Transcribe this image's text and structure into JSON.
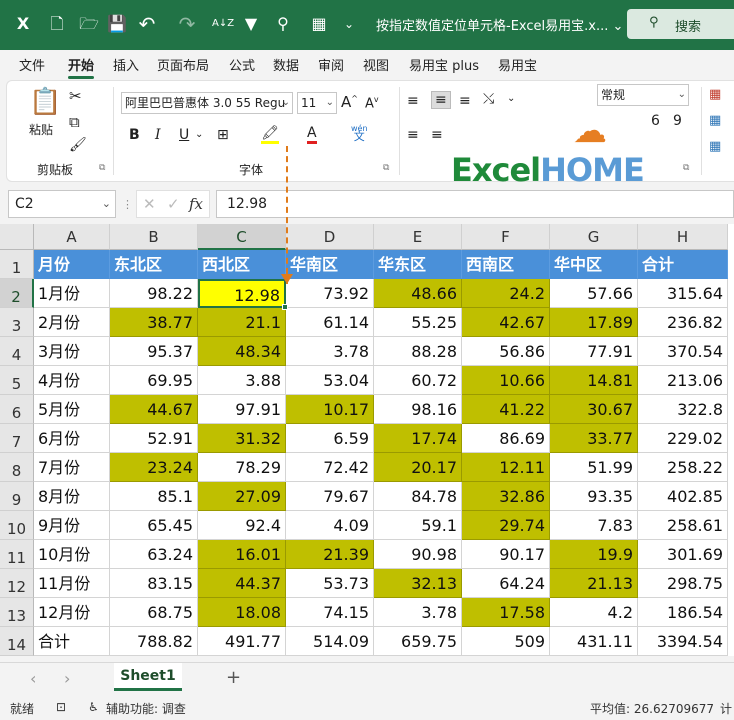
{
  "titlebar": {
    "title": "按指定数值定位单元格-Excel易用宝.x...",
    "dropdown_icon": "⌄",
    "search_label": "搜索",
    "icons": {
      "app": "X",
      "new": "🗋",
      "open": "🗁",
      "save": "💾",
      "undo": "↶",
      "redo": "↷",
      "sort": "A↓Z",
      "find": "⚲",
      "form": "▦"
    }
  },
  "menu": {
    "items": [
      "文件",
      "开始",
      "插入",
      "页面布局",
      "公式",
      "数据",
      "审阅",
      "视图",
      "易用宝 plus",
      "易用宝"
    ],
    "active": "开始"
  },
  "ribbon": {
    "paste_label": "粘贴",
    "clipboard_label": "剪贴板",
    "font_name": "阿里巴巴普惠体 3.0 55 Regu",
    "font_size": "11",
    "font_label": "字体",
    "bold": "B",
    "italic": "I",
    "underline": "U",
    "grow": "A",
    "shrink": "A",
    "wen": "wén",
    "wen_sub": "文",
    "number_format": "常规",
    "logo_excel": "Excel",
    "logo_home": "HOME"
  },
  "formula_bar": {
    "name_box": "C2",
    "fx": "fx",
    "value": "12.98"
  },
  "sheet": {
    "columns": [
      "A",
      "B",
      "C",
      "D",
      "E",
      "F",
      "G",
      "H"
    ],
    "rows": [
      [
        "月份",
        "东北区",
        "西北区",
        "华南区",
        "华东区",
        "西南区",
        "华中区",
        "合计"
      ],
      [
        "1月份",
        "98.22",
        "12.98",
        "73.92",
        "48.66",
        "24.2",
        "57.66",
        "315.64"
      ],
      [
        "2月份",
        "38.77",
        "21.1",
        "61.14",
        "55.25",
        "42.67",
        "17.89",
        "236.82"
      ],
      [
        "3月份",
        "95.37",
        "48.34",
        "3.78",
        "88.28",
        "56.86",
        "77.91",
        "370.54"
      ],
      [
        "4月份",
        "69.95",
        "3.88",
        "53.04",
        "60.72",
        "10.66",
        "14.81",
        "213.06"
      ],
      [
        "5月份",
        "44.67",
        "97.91",
        "10.17",
        "98.16",
        "41.22",
        "30.67",
        "322.8"
      ],
      [
        "6月份",
        "52.91",
        "31.32",
        "6.59",
        "17.74",
        "86.69",
        "33.77",
        "229.02"
      ],
      [
        "7月份",
        "23.24",
        "78.29",
        "72.42",
        "20.17",
        "12.11",
        "51.99",
        "258.22"
      ],
      [
        "8月份",
        "85.1",
        "27.09",
        "79.67",
        "84.78",
        "32.86",
        "93.35",
        "402.85"
      ],
      [
        "9月份",
        "65.45",
        "92.4",
        "4.09",
        "59.1",
        "29.74",
        "7.83",
        "258.61"
      ],
      [
        "10月份",
        "63.24",
        "16.01",
        "21.39",
        "90.98",
        "90.17",
        "19.9",
        "301.69"
      ],
      [
        "11月份",
        "83.15",
        "44.37",
        "53.73",
        "32.13",
        "64.24",
        "21.13",
        "298.75"
      ],
      [
        "12月份",
        "68.75",
        "18.08",
        "74.15",
        "3.78",
        "17.58",
        "4.2",
        "186.54"
      ],
      [
        "合计",
        "788.82",
        "491.77",
        "514.09",
        "659.75",
        "509",
        "431.11",
        "3394.54"
      ]
    ],
    "highlight_color": "#bfbf00",
    "active_cell_color": "#ffff00",
    "header_color": "#4a90d9",
    "highlighted": [
      [
        2,
        4
      ],
      [
        2,
        5
      ],
      [
        3,
        1
      ],
      [
        3,
        2
      ],
      [
        3,
        5
      ],
      [
        3,
        6
      ],
      [
        4,
        2
      ],
      [
        5,
        5
      ],
      [
        5,
        6
      ],
      [
        6,
        1
      ],
      [
        6,
        3
      ],
      [
        6,
        5
      ],
      [
        6,
        6
      ],
      [
        7,
        2
      ],
      [
        7,
        4
      ],
      [
        7,
        6
      ],
      [
        8,
        1
      ],
      [
        8,
        4
      ],
      [
        8,
        5
      ],
      [
        9,
        2
      ],
      [
        9,
        5
      ],
      [
        10,
        5
      ],
      [
        11,
        2
      ],
      [
        11,
        3
      ],
      [
        11,
        6
      ],
      [
        12,
        2
      ],
      [
        12,
        4
      ],
      [
        12,
        6
      ],
      [
        13,
        2
      ],
      [
        13,
        5
      ]
    ],
    "active": [
      2,
      2
    ]
  },
  "sheetbar": {
    "tab": "Sheet1",
    "add": "+",
    "prev": "‹",
    "next": "›"
  },
  "status": {
    "ready": "就绪",
    "accessibility": "辅助功能: 调查",
    "average": "平均值: 26.62709677",
    "count": "计"
  }
}
